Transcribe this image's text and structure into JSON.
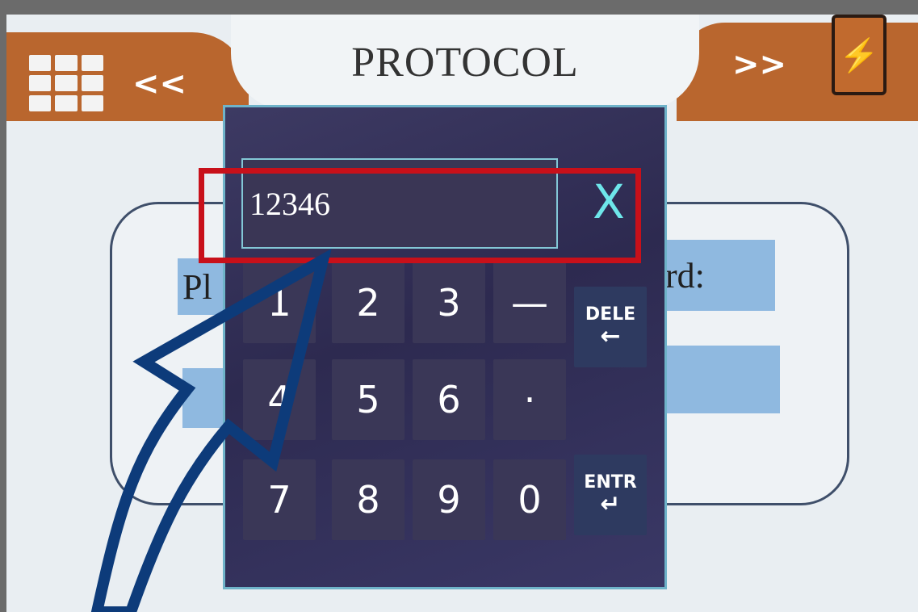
{
  "header": {
    "title": "PROTOCOL",
    "prev_label": "<<",
    "next_label": ">>",
    "menu_icon": "grid-menu-icon",
    "battery_icon": "battery-charging-icon"
  },
  "form": {
    "left_label": "Pl",
    "right_label": "rd:"
  },
  "keypad": {
    "display_value": "12346",
    "close_label": "X",
    "keys": [
      "1",
      "2",
      "3",
      "—",
      "4",
      "5",
      "6",
      "·",
      "7",
      "8",
      "9",
      "0"
    ],
    "delete_label": "DELE",
    "delete_arrow": "←",
    "enter_label": "ENTR",
    "enter_arrow": "↵"
  },
  "colors": {
    "header_orange": "#b9662e",
    "keypad_bg": "#3d3a63",
    "highlight_red": "#c8101a",
    "annotation_arrow": "#0d3b7a"
  }
}
